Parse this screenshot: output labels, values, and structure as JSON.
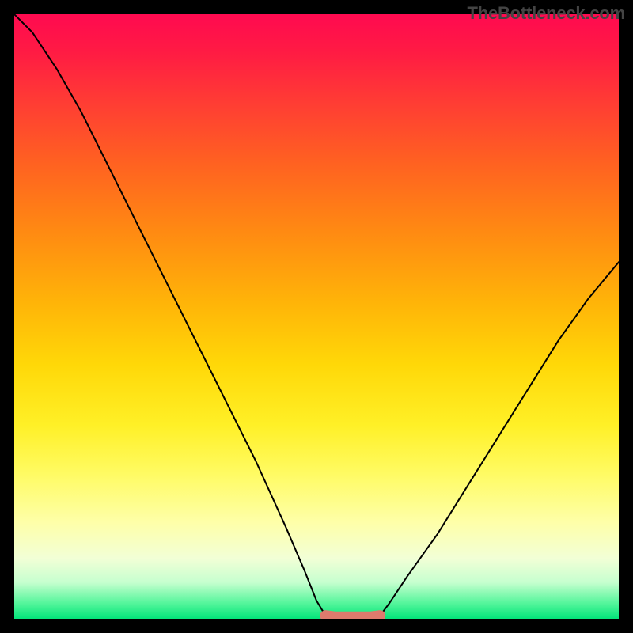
{
  "watermark": "TheBottleneck.com",
  "chart_data": {
    "type": "line",
    "title": "",
    "xlabel": "",
    "ylabel": "",
    "xlim": [
      0,
      100
    ],
    "ylim": [
      0,
      100
    ],
    "series": [
      {
        "name": "left-curve",
        "color": "#000000",
        "x": [
          0,
          3,
          7,
          11,
          15,
          20,
          25,
          30,
          35,
          40,
          45,
          48,
          50,
          51.5
        ],
        "values": [
          100,
          97,
          91,
          84,
          76,
          66,
          56,
          46,
          36,
          26,
          15,
          8,
          3,
          0.5
        ]
      },
      {
        "name": "right-curve",
        "color": "#000000",
        "x": [
          60.5,
          62,
          65,
          70,
          75,
          80,
          85,
          90,
          95,
          100
        ],
        "values": [
          0.5,
          2.5,
          7,
          14,
          22,
          30,
          38,
          46,
          53,
          59
        ]
      },
      {
        "name": "flat-band",
        "color": "#de7a6d",
        "x": [
          51.5,
          53,
          55,
          57,
          59,
          60.5
        ],
        "values": [
          0.5,
          0.3,
          0.3,
          0.3,
          0.3,
          0.5
        ]
      }
    ],
    "styles": {
      "left-curve": {
        "stroke_width": 2
      },
      "right-curve": {
        "stroke_width": 2
      },
      "flat-band": {
        "stroke_width": 14
      }
    }
  }
}
